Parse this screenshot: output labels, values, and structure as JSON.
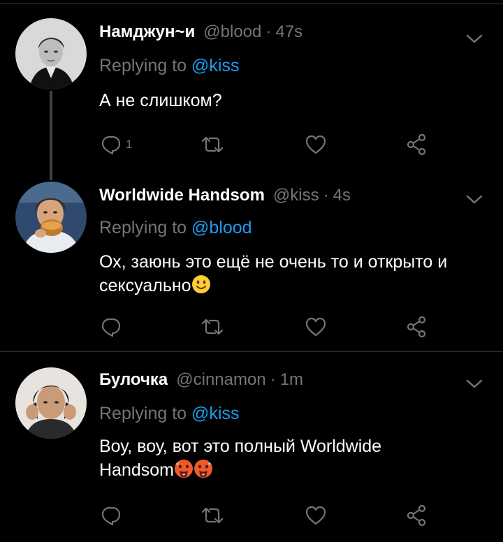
{
  "tweets": [
    {
      "name": "Намджун~и",
      "handle": "@blood",
      "time": "47s",
      "reply_prefix": "Replying to",
      "reply_to": "@kiss",
      "text": "А не слишком?",
      "reply_count": "1"
    },
    {
      "name": "Worldwide Handsom",
      "handle": "@kiss",
      "time": "4s",
      "reply_prefix": "Replying to",
      "reply_to": "@blood",
      "text_line1": "Ох, заюнь это ещё не очень то и открыто и",
      "text_line2": "сексуально"
    },
    {
      "name": "Булочка",
      "handle": "@cinnamon",
      "time": "1m",
      "reply_prefix": "Replying to",
      "reply_to": "@kiss",
      "text_line1": "Воу, воу, вот это полный Worldwide",
      "text_line2": "Handsom"
    }
  ],
  "separator": "·",
  "colors": {
    "background": "#000000",
    "text": "#ffffff",
    "muted": "#71767b",
    "link": "#1d9bf0",
    "divider": "#2f3336"
  },
  "icons": [
    "chevron-down-icon",
    "reply-icon",
    "retweet-icon",
    "like-icon",
    "share-icon",
    "smiling-face-emoji",
    "hot-face-emoji"
  ]
}
